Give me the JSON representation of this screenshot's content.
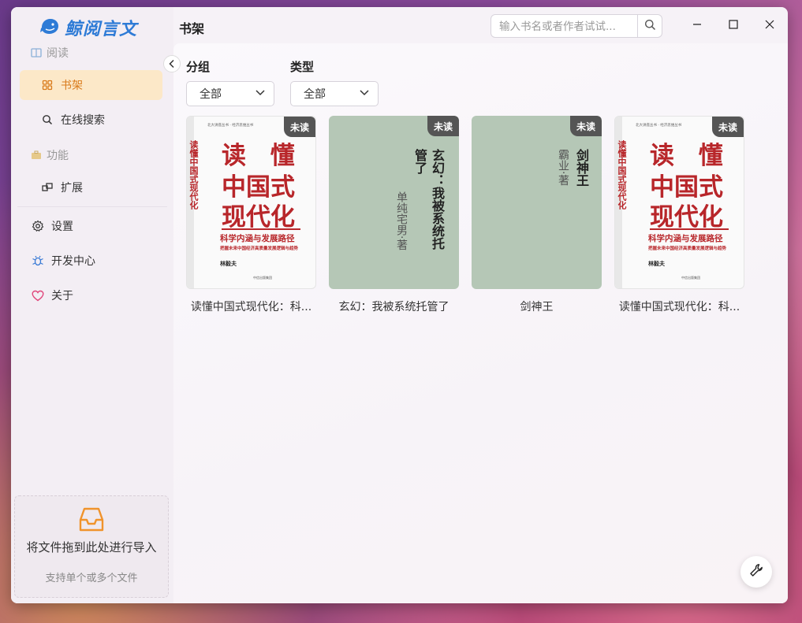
{
  "app": {
    "name": "鲸阅言文",
    "page_title": "书架"
  },
  "search": {
    "placeholder": "输入书名或者作者试试..."
  },
  "sidebar": {
    "sections": [
      {
        "label": "阅读",
        "items": [
          {
            "label": "书架",
            "active": true
          },
          {
            "label": "在线搜索"
          }
        ]
      },
      {
        "label": "功能",
        "items": [
          {
            "label": "扩展"
          }
        ]
      }
    ],
    "bottom": [
      {
        "label": "设置"
      },
      {
        "label": "开发中心"
      },
      {
        "label": "关于"
      }
    ],
    "dropzone": {
      "title": "将文件拖到此处进行导入",
      "hint": "支持单个或多个文件"
    }
  },
  "filters": {
    "group": {
      "label": "分组",
      "value": "全部"
    },
    "type": {
      "label": "类型",
      "value": "全部"
    }
  },
  "books": [
    {
      "title": "读懂中国式现代化：科...",
      "badge": "未读",
      "cover_type": "printed",
      "cover": {
        "series": "北大讲座丛书 · 经济思维丛书",
        "line1": "读 懂",
        "line2": "中国式",
        "line3": "现代化",
        "subtitle": "科学内涵与发展路径",
        "subtitle2": "把握未来中国经济高质量发展逻辑与趋势",
        "spine": "读懂中国式现代化",
        "author": "林毅夫",
        "publisher": "中信出版集团"
      }
    },
    {
      "title": "玄幻：我被系统托管了",
      "badge": "未读",
      "cover_type": "generated",
      "cover": {
        "col1": "玄幻：我被系统托",
        "col2": "管了",
        "author": "单纯宅男·著"
      }
    },
    {
      "title": "剑神王",
      "badge": "未读",
      "cover_type": "generated",
      "cover": {
        "col1": "剑神王",
        "author": "霸业·著"
      }
    },
    {
      "title": "读懂中国式现代化：科...",
      "badge": "未读",
      "cover_type": "printed",
      "cover": {
        "series": "北大讲座丛书 · 经济思维丛书",
        "line1": "读 懂",
        "line2": "中国式",
        "line3": "现代化",
        "subtitle": "科学内涵与发展路径",
        "subtitle2": "把握未来中国经济高质量发展逻辑与趋势",
        "spine": "读懂中国式现代化",
        "author": "林毅夫",
        "publisher": "中信出版集团"
      }
    }
  ],
  "colors": {
    "accent": "#d97a1a",
    "active_bg": "#fce8c8",
    "brand": "#2e7bd6",
    "badge_bg": "#555555",
    "cover_red": "#b8262a",
    "generated_cover": "#b5c7b6"
  },
  "icons": [
    "whale-logo-icon",
    "search-icon",
    "minimize-icon",
    "maximize-icon",
    "close-icon",
    "book-icon",
    "bookshelf-icon",
    "search-icon",
    "toolbox-icon",
    "extension-icon",
    "gear-icon",
    "bug-icon",
    "heart-icon",
    "inbox-icon",
    "chevron-left-icon",
    "chevron-down-icon",
    "wrench-icon"
  ]
}
